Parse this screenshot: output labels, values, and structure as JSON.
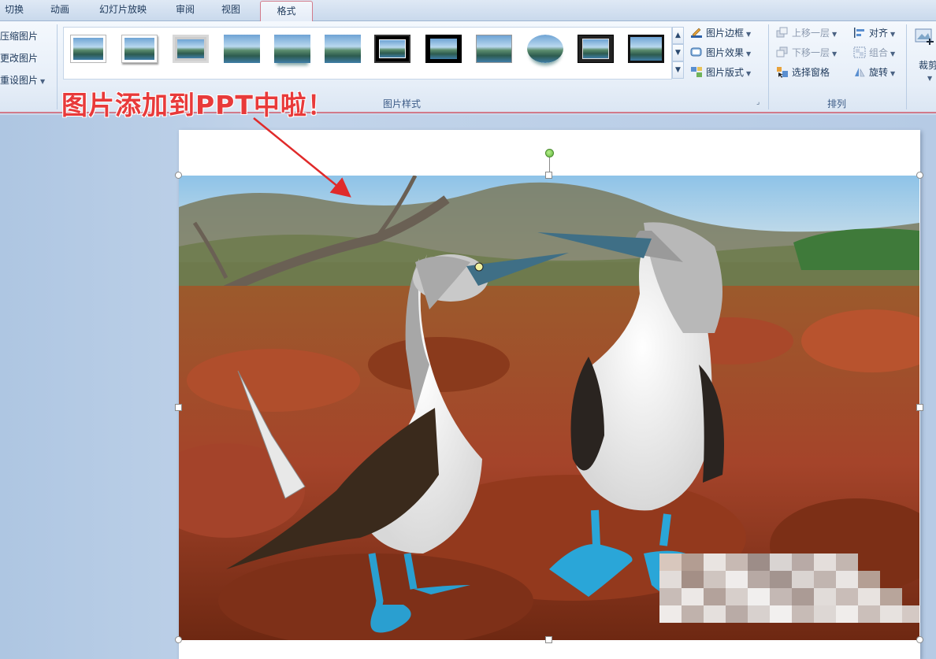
{
  "tabs": [
    {
      "label": "切换",
      "active": false
    },
    {
      "label": "动画",
      "active": false
    },
    {
      "label": "幻灯片放映",
      "active": false
    },
    {
      "label": "审阅",
      "active": false
    },
    {
      "label": "视图",
      "active": false
    },
    {
      "label": "格式",
      "active": true
    }
  ],
  "adjust": {
    "compress": "压缩图片",
    "change": "更改图片",
    "reset": "重设图片"
  },
  "picture_styles": {
    "group_label": "图片样式",
    "styles": [
      "simple-frame-white",
      "soft-edge",
      "beveled-matte",
      "reflected-rect",
      "reflected-soft",
      "rounded-diagonal",
      "thick-black",
      "black-matte",
      "simple-frame-black",
      "oval-reflection",
      "double-frame-black",
      "thick-matte-black"
    ],
    "border": "图片边框",
    "effects": "图片效果",
    "layout": "图片版式"
  },
  "arrange": {
    "group_label": "排列",
    "bring_forward": "上移一层",
    "send_backward": "下移一层",
    "selection_pane": "选择窗格",
    "align": "对齐",
    "group": "组合",
    "rotate": "旋转"
  },
  "size": {
    "crop": "裁剪"
  },
  "annotation": {
    "text": "图片添加到PPT中啦！",
    "color": "#e83a3a"
  },
  "colors": {
    "accent_tab_border": "#d27a8a",
    "ribbon_bg": "#e6eef8",
    "workspace_bg": "#b6cbe5"
  }
}
